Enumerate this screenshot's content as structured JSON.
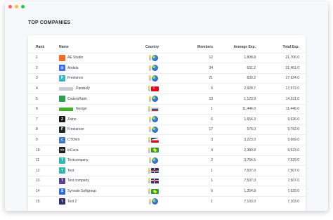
{
  "window": {
    "controls": [
      "close",
      "minimize",
      "maximize"
    ]
  },
  "section_title": "TOP COMPANIES",
  "table": {
    "headers": {
      "rank": "Rank",
      "name": "Name",
      "country": "Country",
      "members": "Members",
      "average_exp": "Average Exp.",
      "total_exp": "Total Exp."
    },
    "rows": [
      {
        "rank": "1",
        "name": "AE Studio",
        "logo_text": "",
        "logo_color": "#f26b21",
        "logo_style": "square",
        "country_icon": "globe-icon",
        "members": "12",
        "average_exp": "1,808.8",
        "total_exp": "21,706.0"
      },
      {
        "rank": "2",
        "name": "Andela",
        "logo_text": "⊙",
        "logo_color": "#3a6ee8",
        "logo_style": "square",
        "country_icon": "globe-icon",
        "members": "34",
        "average_exp": "631.2",
        "total_exp": "21,461.0"
      },
      {
        "rank": "3",
        "name": "Freelance",
        "logo_text": "F",
        "logo_color": "#3ab5c9",
        "logo_style": "square",
        "country_icon": "globe-icon",
        "members": "21",
        "average_exp": "839.2",
        "total_exp": "17,624.0"
      },
      {
        "rank": "4",
        "name": "Parabolŷ",
        "logo_text": "",
        "logo_color": "#c9ccd3",
        "logo_style": "wide",
        "country_icon": "turkey-flag-icon",
        "members": "6",
        "average_exp": "2,928.7",
        "total_exp": "17,572.0"
      },
      {
        "rank": "5",
        "name": "CodersRank",
        "logo_text": "",
        "logo_color": "#2e9e4f",
        "logo_style": "square",
        "country_icon": "globe-icon",
        "members": "13",
        "average_exp": "1,123.9",
        "total_exp": "14,611.0"
      },
      {
        "rank": "6",
        "name": "Nexign",
        "logo_text": "",
        "logo_color": "#43b02a",
        "logo_style": "wide",
        "country_icon": "russia-flag-icon",
        "members": "1",
        "average_exp": "11,446.0",
        "total_exp": "11,446.0"
      },
      {
        "rank": "7",
        "name": "Zajno",
        "logo_text": "Z",
        "logo_color": "#1a1a1a",
        "logo_style": "square",
        "country_icon": "globe-icon",
        "members": "6",
        "average_exp": "1,654.3",
        "total_exp": "9,926.0"
      },
      {
        "rank": "8",
        "name": "Freelancer",
        "logo_text": "F",
        "logo_color": "#22262b",
        "logo_style": "square",
        "country_icon": "globe-icon",
        "members": "17",
        "average_exp": "576.0",
        "total_exp": "9,792.0"
      },
      {
        "rank": "9",
        "name": "CTOhm",
        "logo_text": "c",
        "logo_color": "#3d79c7",
        "logo_style": "square",
        "country_icon": "czech-flag-icon",
        "members": "3",
        "average_exp": "3,223.0",
        "total_exp": "9,669.0"
      },
      {
        "rank": "10",
        "name": "inCuca",
        "logo_text": "<>",
        "logo_color": "#202020",
        "logo_style": "square",
        "country_icon": "brazil-flag-icon",
        "members": "4",
        "average_exp": "2,380.8",
        "total_exp": "9,523.0"
      },
      {
        "rank": "11",
        "name": "Testcompany",
        "logo_text": "T",
        "logo_color": "#2bbab0",
        "logo_style": "square",
        "country_icon": "globe-icon",
        "members": "2",
        "average_exp": "3,764.5",
        "total_exp": "7,529.0"
      },
      {
        "rank": "12",
        "name": "Test",
        "logo_text": "T",
        "logo_color": "#2bbab0",
        "logo_style": "square",
        "country_icon": "uk-flag-icon",
        "members": "1",
        "average_exp": "7,507.0",
        "total_exp": "7,507.0"
      },
      {
        "rank": "13",
        "name": "Test company",
        "logo_text": "T",
        "logo_color": "#5a3e9a",
        "logo_style": "square",
        "country_icon": "uk-flag-icon",
        "members": "1",
        "average_exp": "7,507.0",
        "total_exp": "7,507.0"
      },
      {
        "rank": "14",
        "name": "Synvale Softgroup",
        "logo_text": "S",
        "logo_color": "#2d6fd6",
        "logo_style": "square",
        "country_icon": "brazil-flag-icon",
        "members": "6",
        "average_exp": "1,254.8",
        "total_exp": "7,529.0"
      },
      {
        "rank": "15",
        "name": "Test 2",
        "logo_text": "T",
        "logo_color": "#2b2f6b",
        "logo_style": "square",
        "country_icon": "globe-icon",
        "members": "1",
        "average_exp": "7,103.0",
        "total_exp": "7,103.0"
      }
    ]
  }
}
